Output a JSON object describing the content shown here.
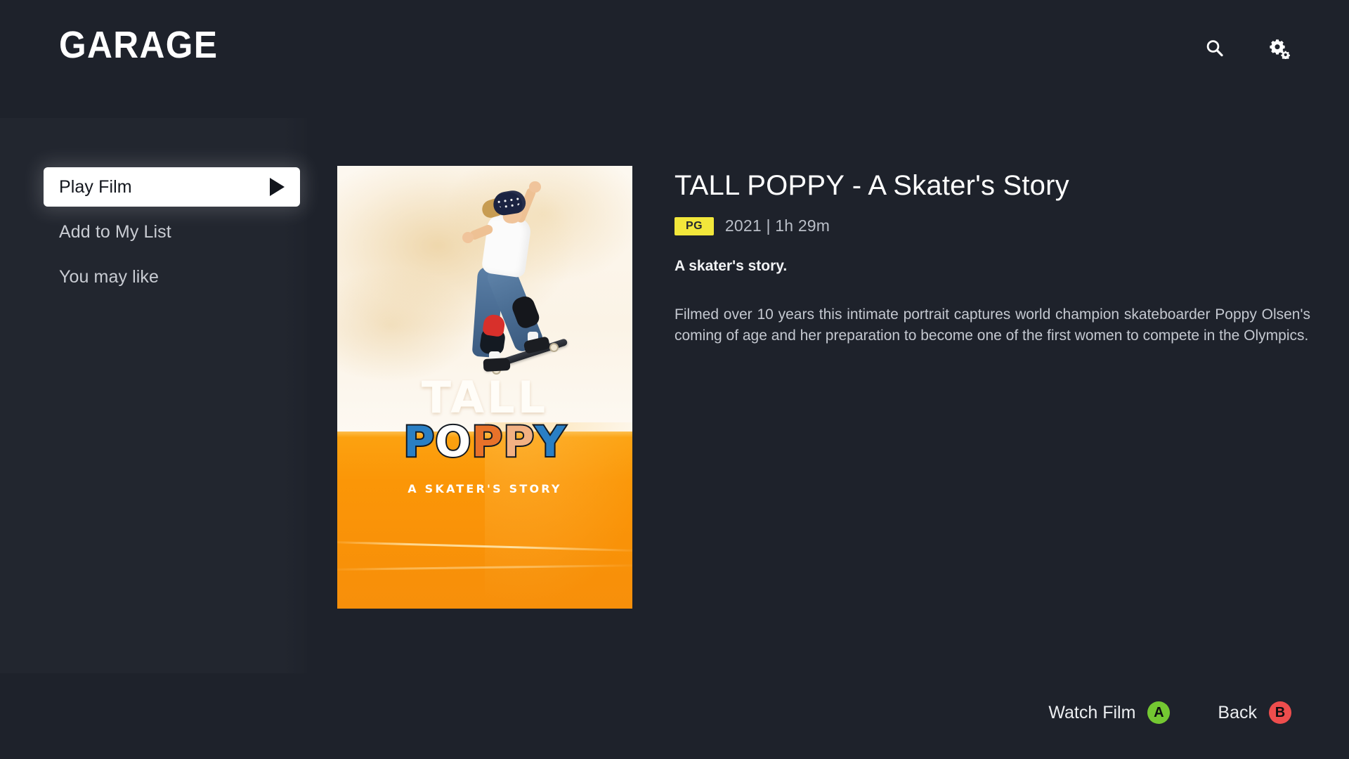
{
  "header": {
    "logo": "GARAGE",
    "search_icon": "search-icon",
    "settings_icon": "gear-icon"
  },
  "menu": {
    "items": [
      {
        "label": "Play Film",
        "selected": true,
        "icon": "play-triangle-icon"
      },
      {
        "label": "Add to My List",
        "selected": false
      },
      {
        "label": "You may like",
        "selected": false
      }
    ]
  },
  "poster": {
    "title_line1": "TALL",
    "title_line2_letters": [
      "P",
      "O",
      "P",
      "P",
      "Y"
    ],
    "subtitle": "A SKATER'S STORY",
    "alt": "skateboarder-poster-image"
  },
  "detail": {
    "title": "TALL POPPY - A Skater's Story",
    "rating": "PG",
    "meta": "2021 | 1h 29m",
    "tagline": "A skater's story.",
    "synopsis": "Filmed over 10 years this intimate portrait captures world champion skateboarder Poppy Olsen's coming of age and her preparation to become one of the first women to compete in the Olympics."
  },
  "hints": [
    {
      "label": "Watch Film",
      "button": "A",
      "color": "#74c832"
    },
    {
      "label": "Back",
      "button": "B",
      "color": "#ed4d4d"
    }
  ],
  "colors": {
    "background": "#1e222b",
    "panel": "#21252f",
    "accent_yellow": "#f2e73b",
    "poster_orange": "#fca311",
    "button_a_green": "#74c832",
    "button_b_red": "#ed4d4d"
  }
}
